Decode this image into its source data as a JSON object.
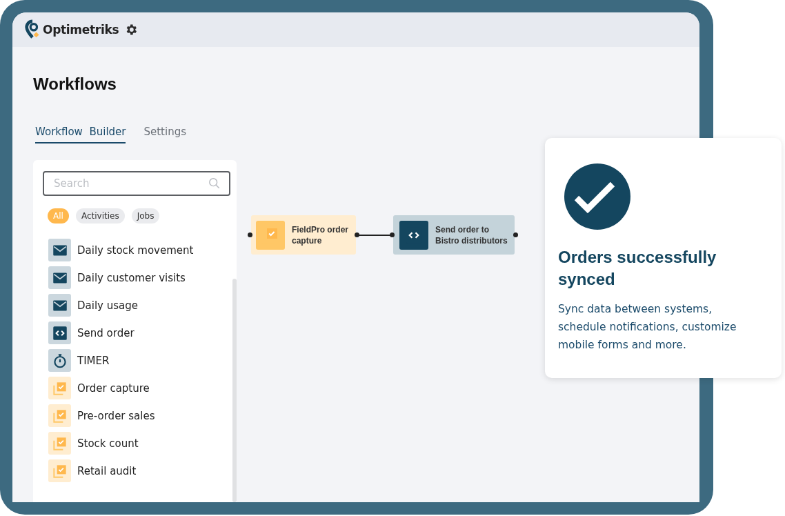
{
  "app": {
    "name": "Optimetriks"
  },
  "page_title": "Workflows",
  "tabs": [
    {
      "label": "Workflow  Builder",
      "selected": true
    },
    {
      "label": "Settings",
      "selected": false
    }
  ],
  "search": {
    "placeholder": "Search"
  },
  "filters": [
    {
      "label": "All",
      "selected": true
    },
    {
      "label": "Activities",
      "selected": false
    },
    {
      "label": "Jobs",
      "selected": false
    }
  ],
  "items": [
    {
      "label": "Daily stock movement",
      "kind": "message"
    },
    {
      "label": "Daily customer visits",
      "kind": "message"
    },
    {
      "label": "Daily usage",
      "kind": "message"
    },
    {
      "label": "Send order",
      "kind": "code"
    },
    {
      "label": "TIMER",
      "kind": "timer"
    },
    {
      "label": "Order capture",
      "kind": "form"
    },
    {
      "label": "Pre-order sales",
      "kind": "form"
    },
    {
      "label": "Stock count",
      "kind": "form"
    },
    {
      "label": "Retail audit",
      "kind": "form"
    }
  ],
  "canvas": {
    "nodes": [
      {
        "label": "FieldPro order capture",
        "kind": "form"
      },
      {
        "label": "Send order to Bistro distributors",
        "kind": "code"
      }
    ]
  },
  "notification": {
    "title": "Orders successfully synced",
    "body": "Sync data between systems, schedule notifications, customize mobile forms and more."
  }
}
